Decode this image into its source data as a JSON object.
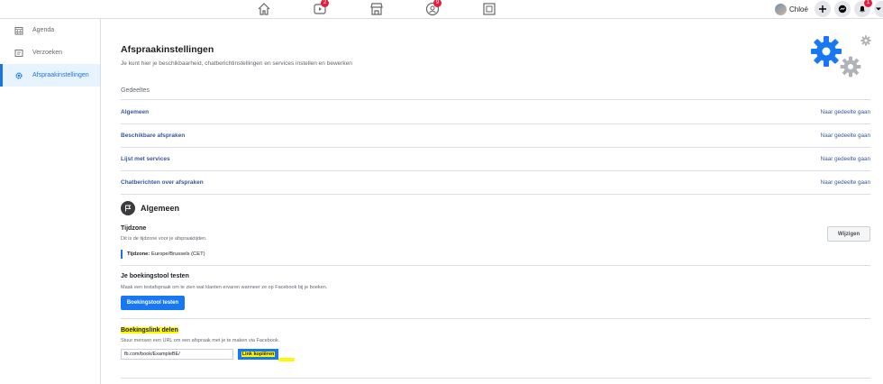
{
  "topbar": {
    "badges": {
      "watch": "2",
      "groups": "9",
      "notifications": "1"
    },
    "profile_name": "Chloé"
  },
  "sidebar": {
    "items": [
      {
        "label": "Agenda",
        "icon": "calendar-icon",
        "active": false
      },
      {
        "label": "Verzoeken",
        "icon": "requests-icon",
        "active": false
      },
      {
        "label": "Afspraakinstellingen",
        "icon": "gear-icon",
        "active": true
      }
    ]
  },
  "main": {
    "title": "Afspraakinstellingen",
    "subtitle": "Je kunt hier je beschikbaarheid, chatberichtinstellingen en services instellen en bewerken",
    "shared_label": "Gedeeltes",
    "shared_rows": [
      {
        "label": "Algemeen",
        "action": "Naar gedeelte gaan"
      },
      {
        "label": "Beschikbare afspraken",
        "action": "Naar gedeelte gaan"
      },
      {
        "label": "Lijst met services",
        "action": "Naar gedeelte gaan"
      },
      {
        "label": "Chatberichten over afspraken",
        "action": "Naar gedeelte gaan"
      }
    ],
    "general": {
      "title": "Algemeen",
      "timezone": {
        "title": "Tijdzone",
        "desc": "Dit is de tijdzone voor je afspraaktijden.",
        "value_label": "Tijdzone:",
        "value": "Europe/Brussels (CET)",
        "edit_button": "Wijzigen"
      },
      "test_tool": {
        "title": "Je boekingstool testen",
        "desc": "Maak een testafspraak om te zien wat klanten ervaren wanneer ze op Facebook bij je boeken.",
        "button": "Boekingstool testen"
      },
      "share_link": {
        "title": "Boekingslink delen",
        "desc": "Stuur mensen een URL om een afspraak met je te maken via Facebook.",
        "url": "fb.com/book/ExampleBE/",
        "copy_button": "Link kopiëren"
      }
    }
  },
  "colors": {
    "accent": "#1877f2",
    "highlight": "#fdf700",
    "link": "#385898"
  }
}
